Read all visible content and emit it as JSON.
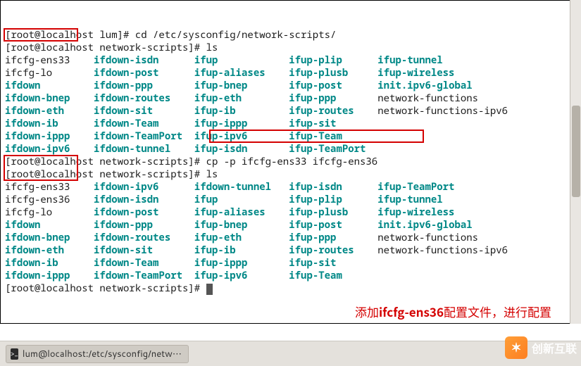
{
  "prompt1": {
    "user": "root",
    "host": "localhost",
    "cwd": "lum",
    "cmd": "cd /etc/sysconfig/network-scripts/"
  },
  "prompt2": {
    "user": "root",
    "host": "localhost",
    "cwd": "network-scripts",
    "cmd": "ls"
  },
  "ls1": {
    "cols": [
      [
        "ifcfg-ens33",
        "ifcfg-lo",
        "ifdown",
        "ifdown-bnep",
        "ifdown-eth",
        "ifdown-ib",
        "ifdown-ippp",
        "ifdown-ipv6"
      ],
      [
        "ifdown-isdn",
        "ifdown-post",
        "ifdown-ppp",
        "ifdown-routes",
        "ifdown-sit",
        "ifdown-Team",
        "ifdown-TeamPort",
        "ifdown-tunnel"
      ],
      [
        "ifup",
        "ifup-aliases",
        "ifup-bnep",
        "ifup-eth",
        "ifup-ib",
        "ifup-ippp",
        "ifup-ipv6",
        "ifup-isdn"
      ],
      [
        "ifup-plip",
        "ifup-plusb",
        "ifup-post",
        "ifup-ppp",
        "ifup-routes",
        "ifup-sit",
        "ifup-Team",
        "ifup-TeamPort"
      ],
      [
        "ifup-tunnel",
        "ifup-wireless",
        "init.ipv6-global",
        "network-functions",
        "network-functions-ipv6",
        "",
        "",
        ""
      ]
    ]
  },
  "prompt3": {
    "user": "root",
    "host": "localhost",
    "cwd": "network-scripts",
    "cmd": "cp -p ifcfg-ens33 ifcfg-ens36"
  },
  "prompt4": {
    "user": "root",
    "host": "localhost",
    "cwd": "network-scripts",
    "cmd": "ls"
  },
  "ls2": {
    "cols": [
      [
        "ifcfg-ens33",
        "ifcfg-ens36",
        "ifcfg-lo",
        "ifdown",
        "ifdown-bnep",
        "ifdown-eth",
        "ifdown-ib",
        "ifdown-ippp"
      ],
      [
        "ifdown-ipv6",
        "ifdown-isdn",
        "ifdown-post",
        "ifdown-ppp",
        "ifdown-routes",
        "ifdown-sit",
        "ifdown-Team",
        "ifdown-TeamPort"
      ],
      [
        "ifdown-tunnel",
        "ifup",
        "ifup-aliases",
        "ifup-bnep",
        "ifup-eth",
        "ifup-ib",
        "ifup-ippp",
        "ifup-ipv6"
      ],
      [
        "ifup-isdn",
        "ifup-plip",
        "ifup-plusb",
        "ifup-post",
        "ifup-ppp",
        "ifup-routes",
        "ifup-sit",
        "ifup-Team"
      ],
      [
        "ifup-TeamPort",
        "ifup-tunnel",
        "ifup-wireless",
        "init.ipv6-global",
        "network-functions",
        "network-functions-ipv6",
        "",
        ""
      ]
    ]
  },
  "prompt5": {
    "user": "root",
    "host": "localhost",
    "cwd": "network-scripts",
    "cmd": ""
  },
  "black_entries": [
    "ifcfg-ens33",
    "ifcfg-ens36",
    "ifcfg-lo",
    "network-functions",
    "network-functions-ipv6"
  ],
  "annotation": {
    "prefix": "添加",
    "bold": "ifcfg-ens36",
    "suffix": "配置文件，进行配置"
  },
  "taskbar": {
    "window_title": "lum@localhost:/etc/sysconfig/netw⋯"
  },
  "watermark": "创新互联"
}
